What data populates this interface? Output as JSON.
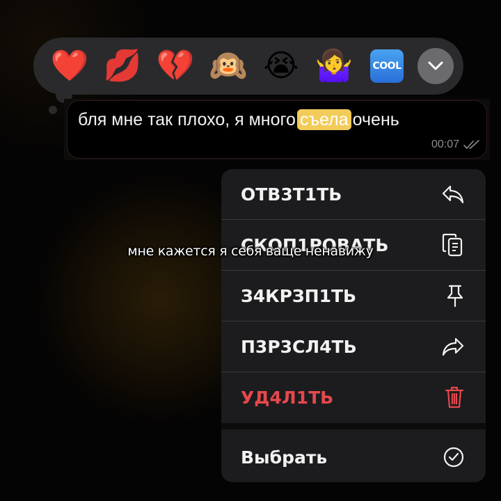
{
  "reactions": {
    "emojis": [
      "❤️",
      "💋",
      "💔",
      "🙉",
      "😭",
      "🤷‍♀️"
    ],
    "cool_label": "COOL",
    "more_icon": "chevron-down-icon"
  },
  "message": {
    "text_before": "бля мне так плохо, я много",
    "highlight": "съела",
    "text_after": "очень",
    "time": "00:07",
    "status_icon": "double-check-icon",
    "highlight_color": "#f2cc5a"
  },
  "menu": {
    "items": [
      {
        "label": "ОТВ3Т1ТЬ",
        "icon": "reply-icon"
      },
      {
        "label": "СКОП1РОВАТЬ",
        "icon": "copy-icon"
      },
      {
        "label": "З4КРЗП1ТЬ",
        "icon": "pin-icon"
      },
      {
        "label": "П3Р3СЛ4ТЬ",
        "icon": "forward-icon"
      },
      {
        "label": "УД4Л1ТЬ",
        "icon": "trash-icon"
      },
      {
        "label": "Выбрать",
        "icon": "check-circle-icon"
      }
    ],
    "danger_color": "#e5484d"
  },
  "caption": "мне кажется я себя ваще ненавижу"
}
